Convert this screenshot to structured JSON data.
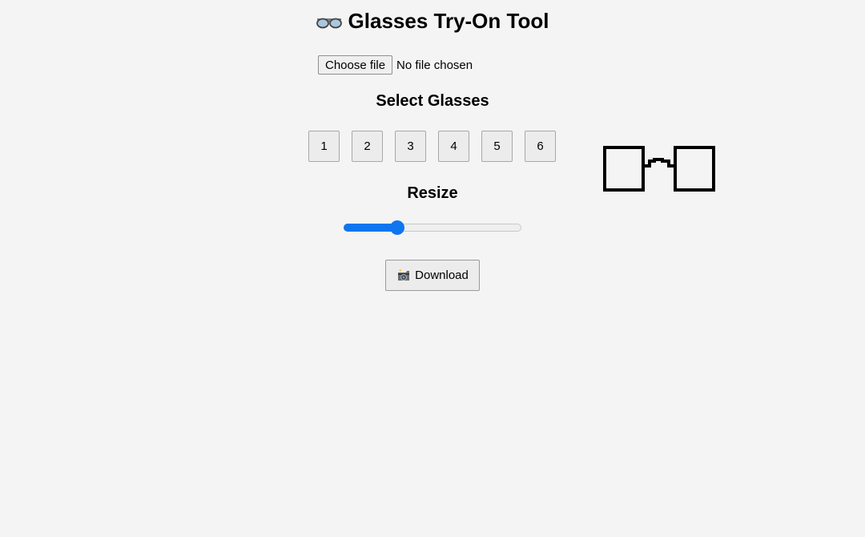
{
  "header": {
    "icon": "eyeglasses-icon",
    "title": "Glasses Try-On Tool"
  },
  "file_input": {
    "button_label": "Choose file",
    "status": "No file chosen"
  },
  "glasses_section": {
    "heading": "Select Glasses",
    "options": [
      "1",
      "2",
      "3",
      "4",
      "5",
      "6"
    ],
    "preview_icon": "square-glasses-icon"
  },
  "resize_section": {
    "heading": "Resize",
    "slider_value": 0.3,
    "accent_color": "#0f76f0"
  },
  "download": {
    "icon": "camera-flash-icon",
    "label": "Download"
  }
}
